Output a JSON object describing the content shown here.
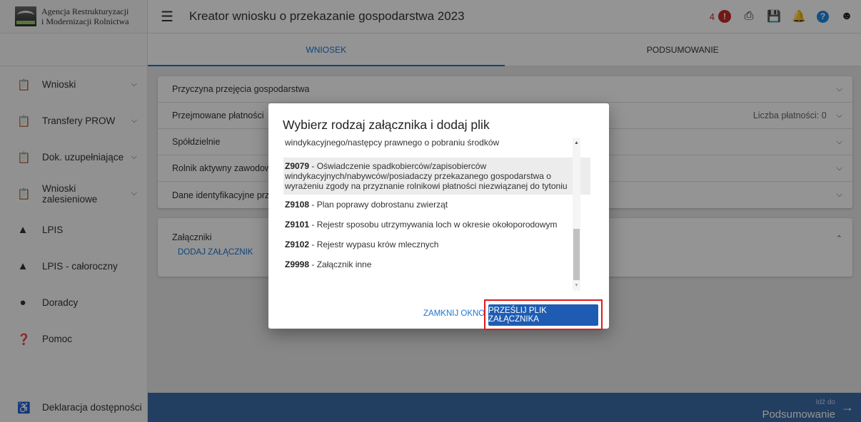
{
  "sidebar": {
    "logo_line1": "Agencja Restrukturyzacji",
    "logo_line2": "i Modernizacji Rolnictwa",
    "items": [
      {
        "label": "Wnioski",
        "icon": "clipboard-icon",
        "has_chevron": true
      },
      {
        "label": "Transfery PROW",
        "icon": "clipboard-icon",
        "has_chevron": true
      },
      {
        "label": "Dok. uzupełniające",
        "icon": "clipboard-icon",
        "has_chevron": true
      },
      {
        "label": "Wnioski zalesieniowe",
        "icon": "clipboard-icon",
        "has_chevron": true
      },
      {
        "label": "LPIS",
        "icon": "mountains-icon",
        "has_chevron": false
      },
      {
        "label": "LPIS - całoroczny",
        "icon": "mountains-icon",
        "has_chevron": false
      },
      {
        "label": "Doradcy",
        "icon": "person-icon",
        "has_chevron": false
      },
      {
        "label": "Pomoc",
        "icon": "help-icon",
        "has_chevron": false
      }
    ],
    "accessibility": "Deklaracja dostępności"
  },
  "header": {
    "title": "Kreator wniosku o przekazanie gospodarstwa 2023",
    "alert_count": "4"
  },
  "tabs": {
    "wniosek": "WNIOSEK",
    "podsumowanie": "PODSUMOWANIE"
  },
  "sections": {
    "przyczyna": "Przyczyna przejęcia gospodarstwa",
    "platnosci": "Przejmowane płatności",
    "platnosci_info": "Liczba płatności: 0",
    "spoldzielnie": "Spółdzielnie",
    "rolnik": "Rolnik aktywny zawodowo",
    "dane": "Dane identyfikacyjne przekazującego"
  },
  "attachments": {
    "title": "Załączniki",
    "add_link": "DODAJ ZAŁĄCZNIK"
  },
  "footer": {
    "next_sub": "Idź do",
    "next_main": "Podsumowanie"
  },
  "modal": {
    "title": "Wybierz rodzaj załącznika i dodaj plik",
    "items": [
      {
        "code": "",
        "text": "windykacyjnego/następcy prawnego o pobraniu środków"
      },
      {
        "code": "Z9079",
        "text": " - Oświadczenie spadkobierców/zapisobierców windykacyjnych/nabywców/posiadaczy przekazanego gospodarstwa o wyrażeniu zgody na przyznanie rolnikowi płatności niezwiązanej do tytoniu"
      },
      {
        "code": "Z9108",
        "text": " - Plan poprawy dobrostanu zwierząt"
      },
      {
        "code": "Z9101",
        "text": " - Rejestr sposobu utrzymywania loch w okresie okołoporodowym"
      },
      {
        "code": "Z9102",
        "text": " - Rejestr wypasu krów mlecznych"
      },
      {
        "code": "Z9998",
        "text": " - Załącznik inne"
      }
    ],
    "close_label": "ZAMKNIJ OKNO",
    "send_label": "PRZEŚLIJ PLIK ZAŁĄCZNIKA"
  }
}
